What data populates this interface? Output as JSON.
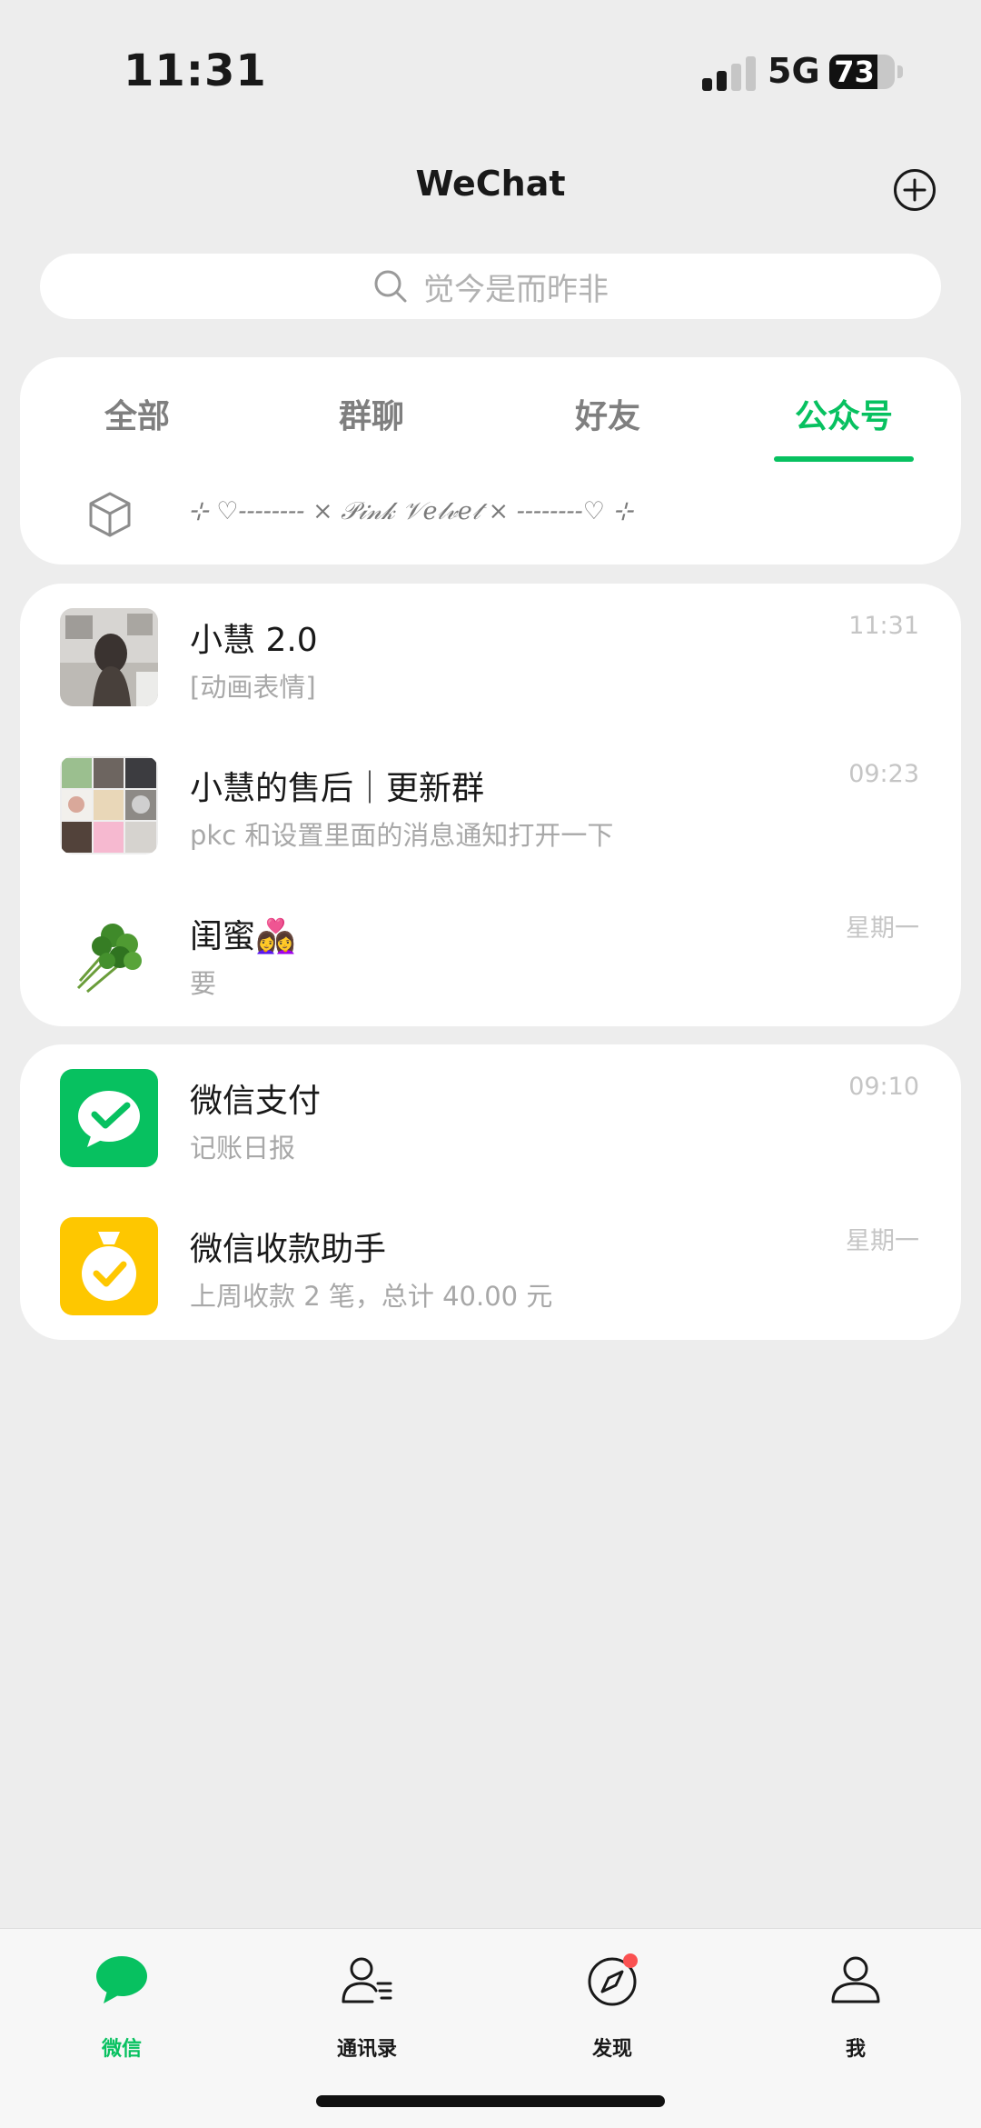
{
  "status_bar": {
    "time": "11:31",
    "network": "5G",
    "battery_percent": 73,
    "battery_label": "73",
    "signal_bars_active": 2,
    "signal_bars_total": 4
  },
  "header": {
    "title": "WeChat",
    "add_icon": "plus-circle-icon"
  },
  "search": {
    "placeholder": "觉今是而昨非",
    "icon": "search-icon"
  },
  "filter": {
    "tabs": [
      {
        "label": "全部",
        "active": false
      },
      {
        "label": "群聊",
        "active": false
      },
      {
        "label": "好友",
        "active": false
      },
      {
        "label": "公众号",
        "active": true
      }
    ],
    "status_icon": "cube-icon",
    "status_text": "⊹ ♡-------- ⨯ 𝒫𝒾𝓃𝓀 𝒱𝑒𝓁𝓋𝑒𝓉 ⨯ --------♡ ⊹"
  },
  "chats": [
    {
      "name": "小慧 2.0",
      "preview": "[动画表情]",
      "time": "11:31",
      "avatar": "photo-avatar"
    },
    {
      "name": "小慧的售后｜更新群",
      "preview": "pkc 和设置里面的消息通知打开一下",
      "time": "09:23",
      "avatar": "group-avatar"
    },
    {
      "name": "闺蜜👩‍❤️‍👩",
      "preview": "要",
      "time": "星期一",
      "avatar": "cilantro-avatar"
    }
  ],
  "services": [
    {
      "name": "微信支付",
      "preview": "记账日报",
      "time": "09:10",
      "avatar": "wechat-pay-icon"
    },
    {
      "name": "微信收款助手",
      "preview": "上周收款 2 笔，总计 40.00 元",
      "time": "星期一",
      "avatar": "payment-assistant-icon"
    }
  ],
  "tabbar": {
    "items": [
      {
        "label": "微信",
        "icon": "chat-bubble-icon",
        "active": true
      },
      {
        "label": "通讯录",
        "icon": "contacts-icon",
        "active": false
      },
      {
        "label": "发现",
        "icon": "compass-icon",
        "active": false,
        "badge": true
      },
      {
        "label": "我",
        "icon": "person-icon",
        "active": false
      }
    ]
  },
  "colors": {
    "accent": "#07c160",
    "background": "#ededed",
    "badge": "#fa5151",
    "assistant_yellow": "#fec700"
  }
}
